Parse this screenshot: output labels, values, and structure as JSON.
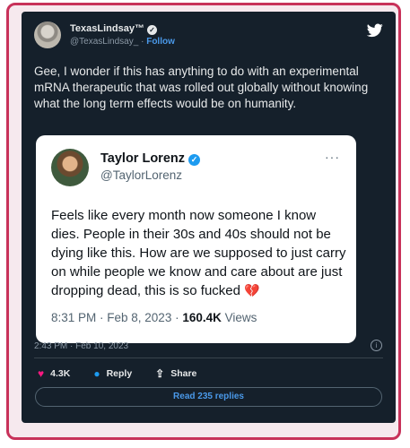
{
  "tweet": {
    "author_name": "TexasLindsay™",
    "author_handle": "@TexasLindsay_",
    "separator": "·",
    "follow_label": "Follow",
    "text": "Gee, I wonder if this has anything to do with an experimental mRNA therapeutic that was rolled out globally without knowing what the long term effects would be on humanity.",
    "timestamp": "2:43 PM · Feb 10, 2023",
    "likes": "4.3K",
    "reply_label": "Reply",
    "share_label": "Share",
    "read_replies_label": "Read 235 replies"
  },
  "quoted": {
    "author_name": "Taylor Lorenz",
    "author_handle": "@TaylorLorenz",
    "more": "···",
    "text": "Feels like every month now someone I know dies. People in their 30s and 40s should not be dying like this. How are we supposed to just carry on while people we know and care about are just dropping dead, this is so fucked",
    "time": "8:31 PM · Feb 8, 2023 · ",
    "views_count": "160.4K",
    "views_label": " Views"
  },
  "icons": {
    "platform": "twitter-bird-icon",
    "verified": "verified-badge-icon",
    "broken_heart": "broken-heart-icon",
    "info": "info-icon",
    "like": "heart-icon",
    "reply": "comment-icon",
    "share": "share-icon"
  },
  "colors": {
    "frame_border": "#c8325a",
    "card_background": "#15202b",
    "link": "#4a99e9",
    "verified_blue": "#1d9bf0",
    "like_pink": "#f91880"
  }
}
